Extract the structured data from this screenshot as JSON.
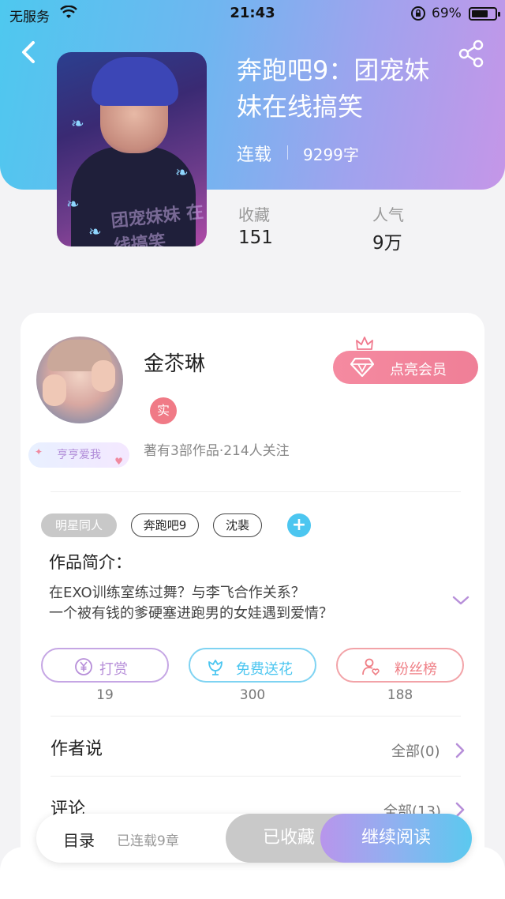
{
  "status_bar": {
    "carrier": "无服务",
    "time": "21:43",
    "battery": "69%"
  },
  "book": {
    "title_line1": "奔跑吧9：团宠妹",
    "title_line2": "妹在线搞笑",
    "status": "连载",
    "word_count": "9299字",
    "cover_watermark": "团宠妹妹 在线搞笑",
    "stats": [
      {
        "label": "收藏",
        "value": "151"
      },
      {
        "label": "人气",
        "value": "9万"
      }
    ]
  },
  "author": {
    "name": "金苶琳",
    "real_badge": "实",
    "tag": "亨亨爱我",
    "meta": "著有3部作品·214人关注",
    "vip_button": "点亮会员"
  },
  "tags": [
    "明星同人",
    "奔跑吧9",
    "沈裴"
  ],
  "intro": {
    "title": "作品简介：",
    "line1": "在EXO训练室练过舞？与李飞合作关系？",
    "line2": "一个被有钱的爹硬塞进跑男的女娃遇到爱情？"
  },
  "actions": [
    {
      "label": "打赏",
      "count": "19",
      "color": "#b78fd9"
    },
    {
      "label": "免费送花",
      "count": "300",
      "color": "#4cc6f0"
    },
    {
      "label": "粉丝榜",
      "count": "188",
      "color": "#ef7f86"
    }
  ],
  "sections": [
    {
      "title": "作者说",
      "right": "全部(0)"
    },
    {
      "title": "评论",
      "right": "全部(13)"
    }
  ],
  "bottom_bar": {
    "toc": "目录",
    "chapters": "已连载9章",
    "collected": "已收藏",
    "continue_reading": "继续阅读"
  },
  "icons": {
    "back": "back-arrow-icon",
    "share": "share-icon",
    "diamond": "diamond-icon",
    "crown": "crown-icon",
    "reward": "yen-coin-icon",
    "flower": "flower-icon",
    "fans": "user-heart-icon",
    "chevron": "chevron-right-icon"
  }
}
